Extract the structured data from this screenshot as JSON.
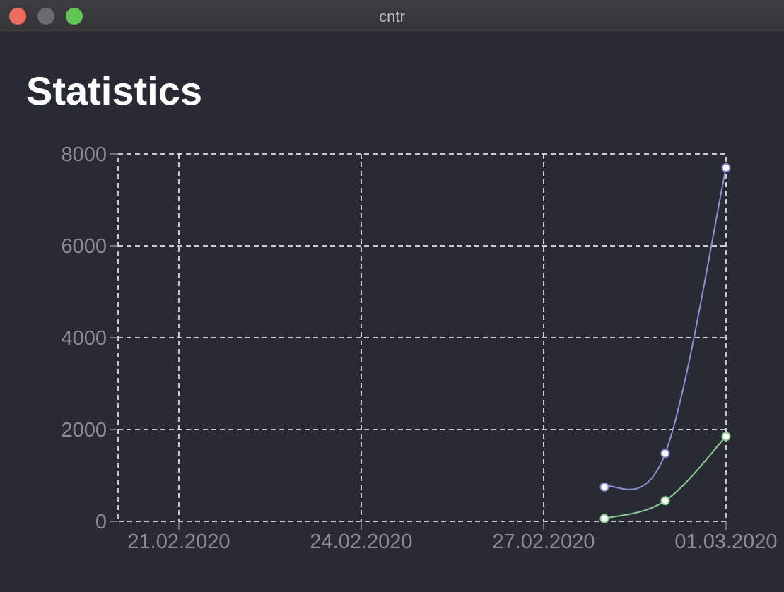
{
  "window": {
    "title": "cntr",
    "controls": {
      "close_color": "#ed6a5e",
      "minimize_color": "#6b6b6d",
      "zoom_color": "#61c554"
    }
  },
  "page": {
    "title": "Statistics"
  },
  "chart_data": {
    "type": "line",
    "title": "",
    "xlabel": "",
    "ylabel": "",
    "x_ticks": [
      "21.02.2020",
      "24.02.2020",
      "27.02.2020",
      "01.03.2020"
    ],
    "xlim": [
      "20.02.2020",
      "01.03.2020"
    ],
    "y_ticks": [
      0,
      2000,
      4000,
      6000,
      8000
    ],
    "ylim": [
      0,
      8000
    ],
    "grid": true,
    "legend": "none",
    "series": [
      {
        "color": "#8e8fd8",
        "x": [
          "28.02.2020",
          "29.02.2020",
          "01.03.2020"
        ],
        "values": [
          750,
          1480,
          7700
        ]
      },
      {
        "color": "#8fcc98",
        "x": [
          "28.02.2020",
          "29.02.2020",
          "01.03.2020"
        ],
        "values": [
          60,
          450,
          1850
        ]
      }
    ]
  }
}
